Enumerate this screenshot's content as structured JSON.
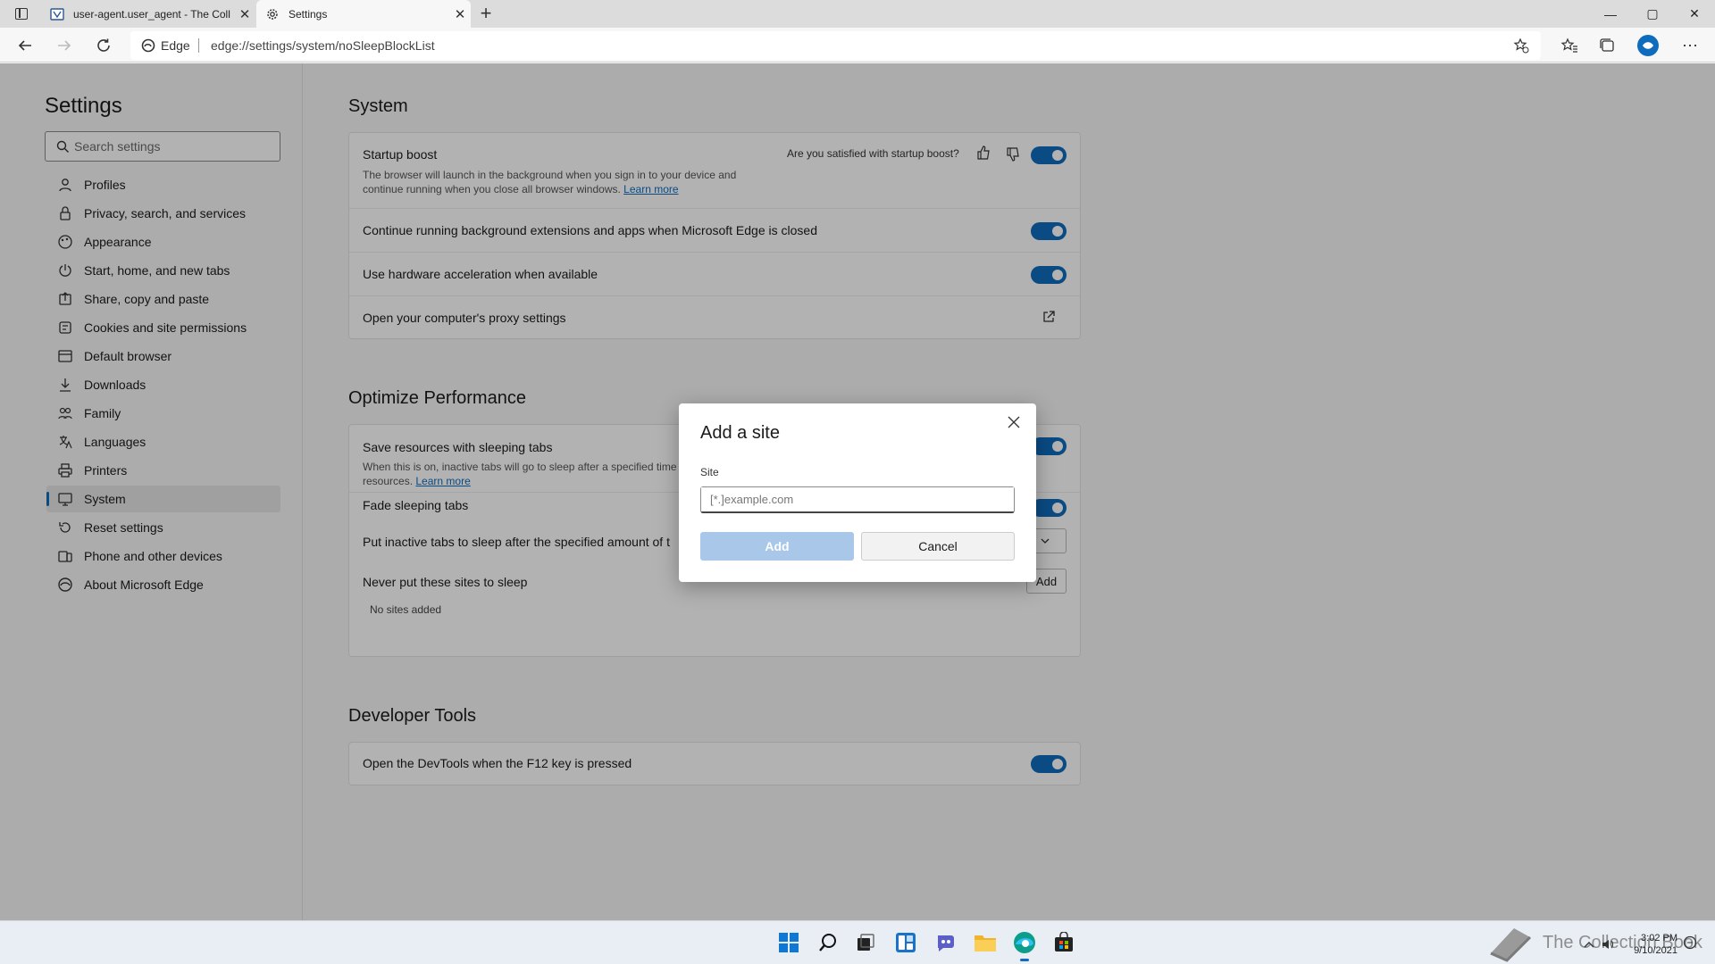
{
  "tabs": [
    {
      "title": "user-agent.user_agent - The Coll",
      "icon": "collection-book-icon"
    },
    {
      "title": "Settings",
      "icon": "gear-icon"
    }
  ],
  "window_controls": {
    "minimize": "—",
    "maximize": "▢",
    "close": "✕"
  },
  "address_bar": {
    "edge_label": "Edge",
    "url": "edge://settings/system/noSleepBlockList"
  },
  "sidebar": {
    "title": "Settings",
    "search_placeholder": "Search settings",
    "items": [
      {
        "label": "Profiles",
        "icon": "profile-icon"
      },
      {
        "label": "Privacy, search, and services",
        "icon": "lock-icon"
      },
      {
        "label": "Appearance",
        "icon": "appearance-icon"
      },
      {
        "label": "Start, home, and new tabs",
        "icon": "power-icon"
      },
      {
        "label": "Share, copy and paste",
        "icon": "share-icon"
      },
      {
        "label": "Cookies and site permissions",
        "icon": "cookie-icon"
      },
      {
        "label": "Default browser",
        "icon": "browser-icon"
      },
      {
        "label": "Downloads",
        "icon": "download-icon"
      },
      {
        "label": "Family",
        "icon": "family-icon"
      },
      {
        "label": "Languages",
        "icon": "language-icon"
      },
      {
        "label": "Printers",
        "icon": "printer-icon"
      },
      {
        "label": "System",
        "icon": "system-icon",
        "active": true
      },
      {
        "label": "Reset settings",
        "icon": "reset-icon"
      },
      {
        "label": "Phone and other devices",
        "icon": "phone-icon"
      },
      {
        "label": "About Microsoft Edge",
        "icon": "edge-icon"
      }
    ]
  },
  "system": {
    "heading": "System",
    "startup_boost": {
      "title": "Startup boost",
      "desc_line1": "The browser will launch in the background when you sign in to your device and",
      "desc_line2": "continue running when you close all browser windows.",
      "learn_more": "Learn more",
      "feedback_question": "Are you satisfied with startup boost?",
      "enabled": true
    },
    "background_apps": {
      "title": "Continue running background extensions and apps when Microsoft Edge is closed",
      "enabled": true
    },
    "hardware_accel": {
      "title": "Use hardware acceleration when available",
      "enabled": true
    },
    "proxy": {
      "title": "Open your computer's proxy settings"
    }
  },
  "optimize": {
    "heading": "Optimize Performance",
    "sleeping_tabs": {
      "title": "Save resources with sleeping tabs",
      "desc_line1": "When this is on, inactive tabs will go to sleep after a specified time",
      "desc_line2": "resources.",
      "learn_more": "Learn more",
      "enabled": true
    },
    "fade_tabs": {
      "title": "Fade sleeping tabs",
      "enabled": true
    },
    "inactive_tabs": {
      "title": "Put inactive tabs to sleep after the specified amount of t"
    },
    "never_sleep": {
      "title": "Never put these sites to sleep",
      "add_label": "Add",
      "empty_text": "No sites added"
    }
  },
  "devtools": {
    "heading": "Developer Tools",
    "f12": {
      "title": "Open the DevTools when the F12 key is pressed",
      "enabled": true
    }
  },
  "dialog": {
    "title": "Add a site",
    "field_label": "Site",
    "placeholder": "[*.]example.com",
    "add_label": "Add",
    "cancel_label": "Cancel"
  },
  "taskbar": {
    "apps": [
      "windows-start-icon",
      "search-icon",
      "task-view-icon",
      "widgets-icon",
      "teams-chat-icon",
      "file-explorer-icon",
      "edge-icon",
      "store-icon"
    ],
    "time": "3:02 PM",
    "date": "9/10/2021",
    "watermark": "The Collection Book"
  },
  "colors": {
    "accent": "#0f6cbd",
    "add_disabled": "#a9c7e8"
  }
}
